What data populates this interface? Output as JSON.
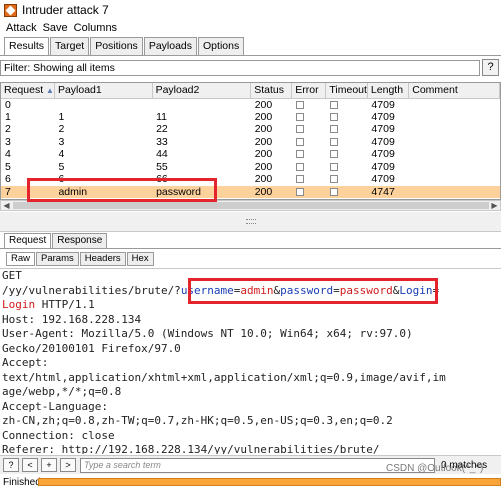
{
  "window": {
    "title": "Intruder attack 7"
  },
  "menu": [
    "Attack",
    "Save",
    "Columns"
  ],
  "top_tabs": [
    "Results",
    "Target",
    "Positions",
    "Payloads",
    "Options"
  ],
  "filter": {
    "text": "Filter: Showing all items",
    "help": "?"
  },
  "table": {
    "columns": [
      "Request",
      "Payload1",
      "Payload2",
      "Status",
      "Error",
      "Timeout",
      "Length",
      "Comment"
    ],
    "rows": [
      {
        "request": "0",
        "p1": "",
        "p2": "",
        "status": "200",
        "length": "4709"
      },
      {
        "request": "1",
        "p1": "1",
        "p2": "11",
        "status": "200",
        "length": "4709"
      },
      {
        "request": "2",
        "p1": "2",
        "p2": "22",
        "status": "200",
        "length": "4709"
      },
      {
        "request": "3",
        "p1": "3",
        "p2": "33",
        "status": "200",
        "length": "4709"
      },
      {
        "request": "4",
        "p1": "4",
        "p2": "44",
        "status": "200",
        "length": "4709"
      },
      {
        "request": "5",
        "p1": "5",
        "p2": "55",
        "status": "200",
        "length": "4709"
      },
      {
        "request": "6",
        "p1": "6",
        "p2": "66",
        "status": "200",
        "length": "4709"
      },
      {
        "request": "7",
        "p1": "admin",
        "p2": "password",
        "status": "200",
        "length": "4747"
      }
    ],
    "selected_row": 7
  },
  "mid_tabs": [
    "Request",
    "Response"
  ],
  "sub_tabs": [
    "Raw",
    "Params",
    "Headers",
    "Hex"
  ],
  "request_text": {
    "l1": "GET",
    "l2_pre": "/yy/vulnerabilities/brute/?",
    "l2_k1": "username",
    "l2_eq1": "=",
    "l2_v1": "admin",
    "l2_amp1": "&",
    "l2_k2": "password",
    "l2_eq2": "=",
    "l2_v2": "password",
    "l2_amp2": "&",
    "l2_k3": "Login",
    "l2_eq3": "=",
    "l3_v3": "Login",
    "l3_rest": " HTTP/1.1",
    "l4": "Host: 192.168.228.134",
    "l5": "User-Agent: Mozilla/5.0 (Windows NT 10.0; Win64; x64; rv:97.0)",
    "l6": "Gecko/20100101 Firefox/97.0",
    "l7": "Accept:",
    "l8": "text/html,application/xhtml+xml,application/xml;q=0.9,image/avif,im",
    "l9": "age/webp,*/*;q=0.8",
    "l10": "Accept-Language:",
    "l11": "zh-CN,zh;q=0.8,zh-TW;q=0.7,zh-HK;q=0.5,en-US;q=0.3,en;q=0.2",
    "l12": "Connection: close",
    "l13": "Referer: http://192.168.228.134/yy/vulnerabilities/brute/"
  },
  "bottom": {
    "buttons": [
      "?",
      "<",
      "+",
      ">"
    ],
    "search_placeholder": "Type a search term",
    "matches": "0 matches"
  },
  "status": {
    "text": "Finished"
  },
  "watermark": "CSDN @Outlook(^_^)",
  "colors": {
    "selected_row": "#fcd19c",
    "annotation": "#e4242c",
    "param_value": "#d21b1b",
    "param_key": "#1a3db3",
    "progress": "#f9a53a"
  }
}
